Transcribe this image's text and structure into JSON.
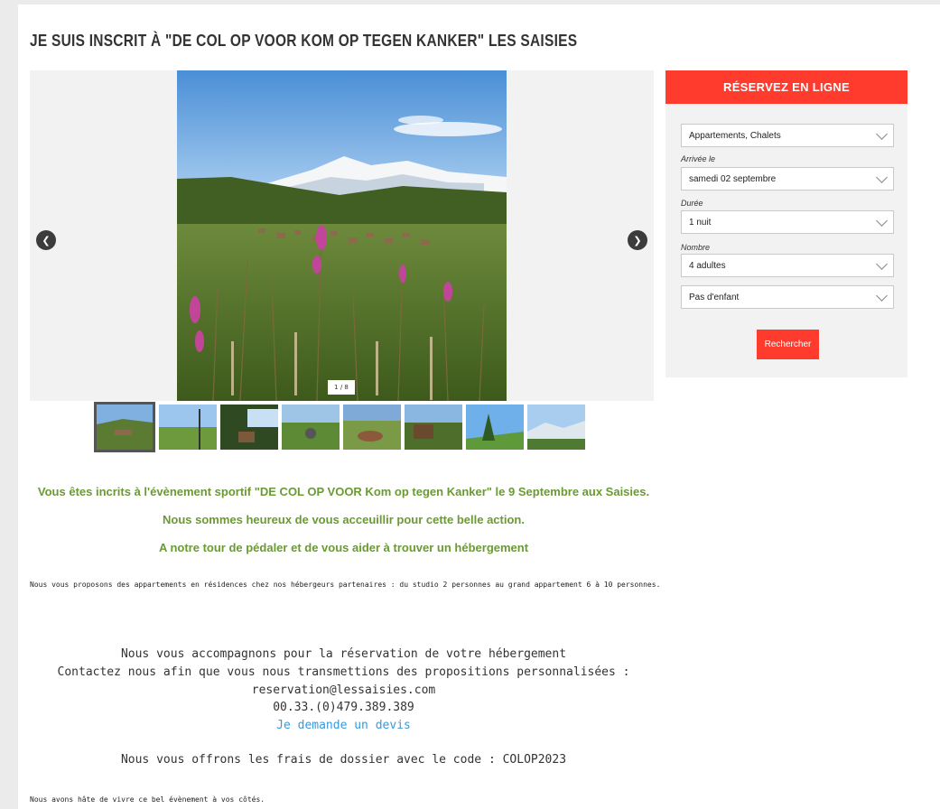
{
  "title": "JE SUIS INSCRIT À \"DE COL OP VOOR KOM OP TEGEN KANKER\" LES SAISIES",
  "carousel": {
    "prev_icon": "chevron-left-icon",
    "next_icon": "chevron-right-icon",
    "prev_glyph": "❮",
    "next_glyph": "❯",
    "counter": "1 / 8",
    "thumb_count": 8
  },
  "booking": {
    "header": "RÉSERVEZ EN LIGNE",
    "type_value": "Appartements, Chalets",
    "arrival_label": "Arrivée le",
    "arrival_value": "samedi 02 septembre",
    "duration_label": "Durée",
    "duration_value": "1 nuit",
    "number_label": "Nombre",
    "adults_value": "4 adultes",
    "children_value": "Pas d'enfant",
    "search_label": "Rechercher",
    "accent_color": "#ff3b2e"
  },
  "content": {
    "line1": "Vous êtes incrits à l'évènement sportif \"DE COL OP VOOR Kom op tegen Kanker\" le 9 Septembre aux Saisies.",
    "line2": "Nous sommes heureux de vous acceuillir pour cette belle action.",
    "line3": "A notre tour de pédaler et de vous aider à trouver un hébergement",
    "paragraph": "Nous vous proposons des appartements en résidences chez nos hébergeurs partenaires :  du studio 2 personnes au grand appartement 6 à 10 personnes.",
    "contact1": "Nous vous accompagnons pour la réservation de votre hébergement",
    "contact2": "Contactez  nous  afin que vous nous transmettions des propositions personnalisées :",
    "email": "reservation@lessaisies.com",
    "phone": "00.33.(0)479.389.389",
    "quote_link": "Je demande un devis",
    "offer": "Nous vous offrons les frais de dossier avec le code : COLOP2023",
    "closing": "Nous avons hâte de vivre ce bel évènement à vos côtés.",
    "green_color": "#6a9a33",
    "link_color": "#3a9ad9"
  }
}
